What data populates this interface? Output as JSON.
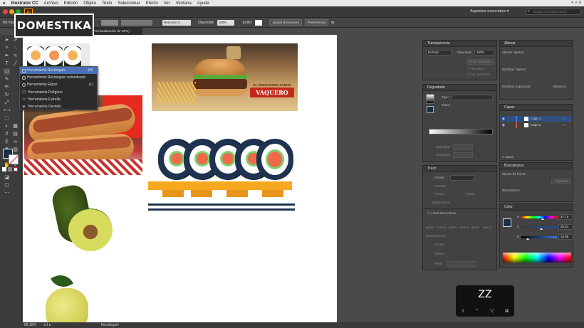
{
  "menubar": {
    "app": "Illustrator CC",
    "items": [
      "Archivo",
      "Edición",
      "Objeto",
      "Texto",
      "Seleccionar",
      "Efecto",
      "Ver",
      "Ventana",
      "Ayuda"
    ]
  },
  "appbar": {
    "app_icon": "Ai",
    "workspace": "Aspectos esenciales",
    "search_placeholder": "Buscar en Adobe Stock"
  },
  "controlbar": {
    "selection_label": "No hay selección",
    "stroke_profile": "Redondo 3...",
    "opacity_label": "Opacidad:",
    "opacity_value": "100%",
    "style_label": "Estilo:",
    "adjust_doc": "Ajustar documento",
    "preferences": "Preferencias"
  },
  "document": {
    "tab_title": "ELEMENTOS COMIDA.ai* al 88,18% (RGB/Previsualización de GPU)",
    "zoom": "88,18%",
    "status_tool": "Rectángulo"
  },
  "logo": "DOMESTIKA",
  "flyout": {
    "items": [
      {
        "label": "Herramienta Rectángulo",
        "key": "(M)",
        "icon": "rectangle-icon"
      },
      {
        "label": "Herramienta Rectángulo redondeado",
        "key": "",
        "icon": "rounded-rectangle-icon"
      },
      {
        "label": "Herramienta Elipse",
        "key": "(L)",
        "icon": "ellipse-icon"
      },
      {
        "label": "Herramienta Polígono",
        "key": "",
        "icon": "polygon-icon"
      },
      {
        "label": "Herramienta Estrella",
        "key": "",
        "icon": "star-icon"
      },
      {
        "label": "Herramienta Destello",
        "key": "",
        "icon": "flare-icon"
      }
    ]
  },
  "artwork": {
    "banner_line1": "EL VERDADERO SABOR",
    "banner_line2": "VAQUERO"
  },
  "panels": {
    "transparency": {
      "title": "Transparencia",
      "mode": "Normal",
      "opacity_label": "Opacidad:",
      "opacity_value": "100%",
      "create_mask": "Crear máscara",
      "clip": "Recortar",
      "invert_mask": "Inv. máscara"
    },
    "gradient": {
      "title": "Degradado",
      "type_label": "Tipo:",
      "stroke_label": "Trazo:",
      "opacity_label": "Opacidad:",
      "location_label": "Ubicación:"
    },
    "stroke": {
      "title": "Trazo",
      "weight_label": "Grosor:",
      "cap_label": "Remate:",
      "corner_label": "Vértice:",
      "limit_label": "Límite:",
      "align_label": "Alinear trazo:",
      "dashed_label": "Línea discontinua",
      "dash_labels": [
        "guión",
        "hueco",
        "guión",
        "hueco",
        "guión",
        "hueco"
      ],
      "arrow_label": "Puntas flecha:",
      "scale_label": "Escala:",
      "align_arrow_label": "Alinear:",
      "profile_label": "Perfil:"
    },
    "align": {
      "title": "Alinear",
      "align_objects": "Alinear objetos:",
      "distribute_objects": "Distribuir objetos:",
      "distribute_spacing": "Distribuir espaciado:",
      "align_to": "Alinear a:"
    },
    "layers": {
      "title": "Capas",
      "rows": [
        "Capa 1",
        "Capa 2"
      ],
      "footer": "2 capas"
    },
    "pathfinder": {
      "title": "Buscatrazos",
      "shape_modes": "Modos de forma:",
      "expand": "Expandir",
      "pathfinders": "Buscatrazos:"
    },
    "color": {
      "title": "Color",
      "h_label": "H",
      "h_value": "217,5",
      "s_label": "S",
      "s_value": "55,81",
      "b_label": "B",
      "b_value": "16,86",
      "h_fill": 0.6,
      "s_fill": 0.56,
      "b_fill": 0.17
    }
  },
  "keystroke": {
    "key": "ZZ",
    "modifiers": [
      "⇧",
      "⌃",
      "⌥",
      "⌘"
    ]
  },
  "colors": {
    "fill_swatch": "#1b2d44",
    "selection_blue": "#4a6fb6",
    "sushi_dark": "#1f3350"
  }
}
